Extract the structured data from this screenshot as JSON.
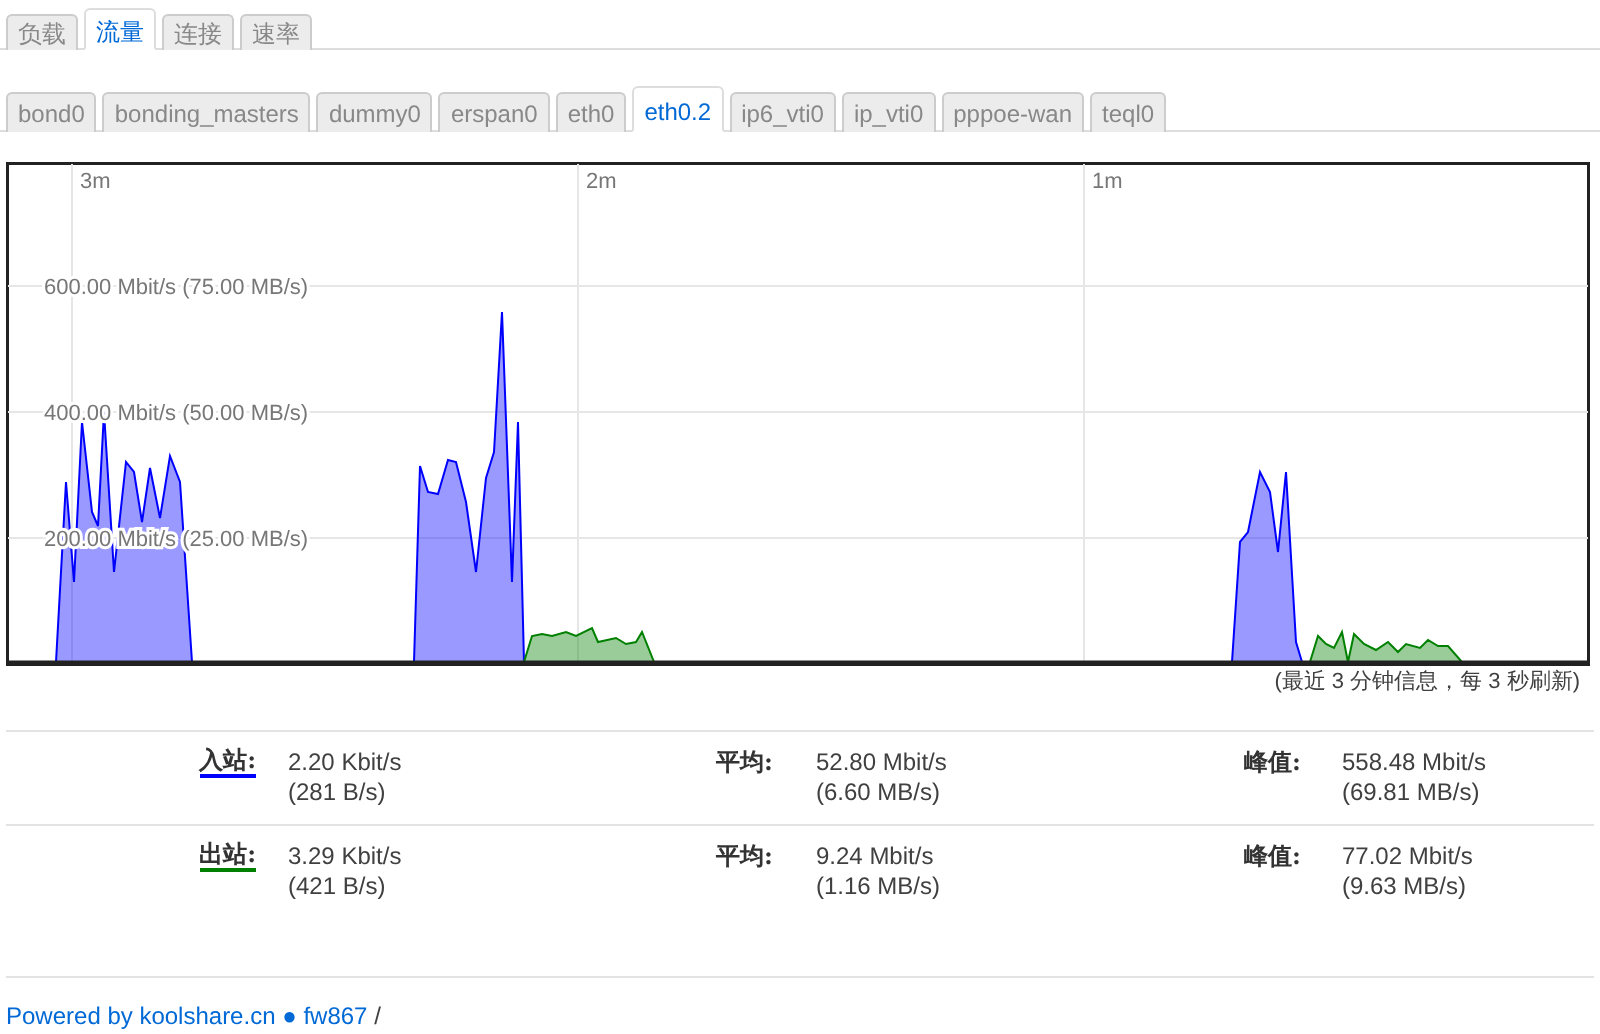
{
  "top_tabs": [
    {
      "label": "负载",
      "selected": false
    },
    {
      "label": "流量",
      "selected": true
    },
    {
      "label": "连接",
      "selected": false
    },
    {
      "label": "速率",
      "selected": false
    }
  ],
  "interface_tabs": [
    {
      "label": "bond0",
      "selected": false
    },
    {
      "label": "bonding_masters",
      "selected": false
    },
    {
      "label": "dummy0",
      "selected": false
    },
    {
      "label": "erspan0",
      "selected": false
    },
    {
      "label": "eth0",
      "selected": false
    },
    {
      "label": "eth0.2",
      "selected": true
    },
    {
      "label": "ip6_vti0",
      "selected": false
    },
    {
      "label": "ip_vti0",
      "selected": false
    },
    {
      "label": "pppoe-wan",
      "selected": false
    },
    {
      "label": "teql0",
      "selected": false
    }
  ],
  "chart": {
    "x_labels": [
      "3m",
      "2m",
      "1m"
    ],
    "y_labels": [
      "600.00 Mbit/s (75.00 MB/s)",
      "400.00 Mbit/s (50.00 MB/s)",
      "200.00 Mbit/s (25.00 MB/s)"
    ]
  },
  "chart_caption": "(最近 3 分钟信息，每 3 秒刷新)",
  "stats": [
    {
      "label": "入站:",
      "color": "#0000ff",
      "current": [
        "2.20 Kbit/s",
        "(281 B/s)"
      ],
      "avg_label": "平均:",
      "avg": [
        "52.80 Mbit/s",
        "(6.60 MB/s)"
      ],
      "peak_label": "峰值:",
      "peak": [
        "558.48 Mbit/s",
        "(69.81 MB/s)"
      ]
    },
    {
      "label": "出站:",
      "color": "#008000",
      "current": [
        "3.29 Kbit/s",
        "(421 B/s)"
      ],
      "avg_label": "平均:",
      "avg": [
        "9.24 Mbit/s",
        "(1.16 MB/s)"
      ],
      "peak_label": "峰值:",
      "peak": [
        "77.02 Mbit/s",
        "(9.63 MB/s)"
      ]
    }
  ],
  "footer": {
    "links": [
      "Powered by koolshare.cn",
      "fw867"
    ],
    "separator": "●",
    "trail": "/"
  }
}
